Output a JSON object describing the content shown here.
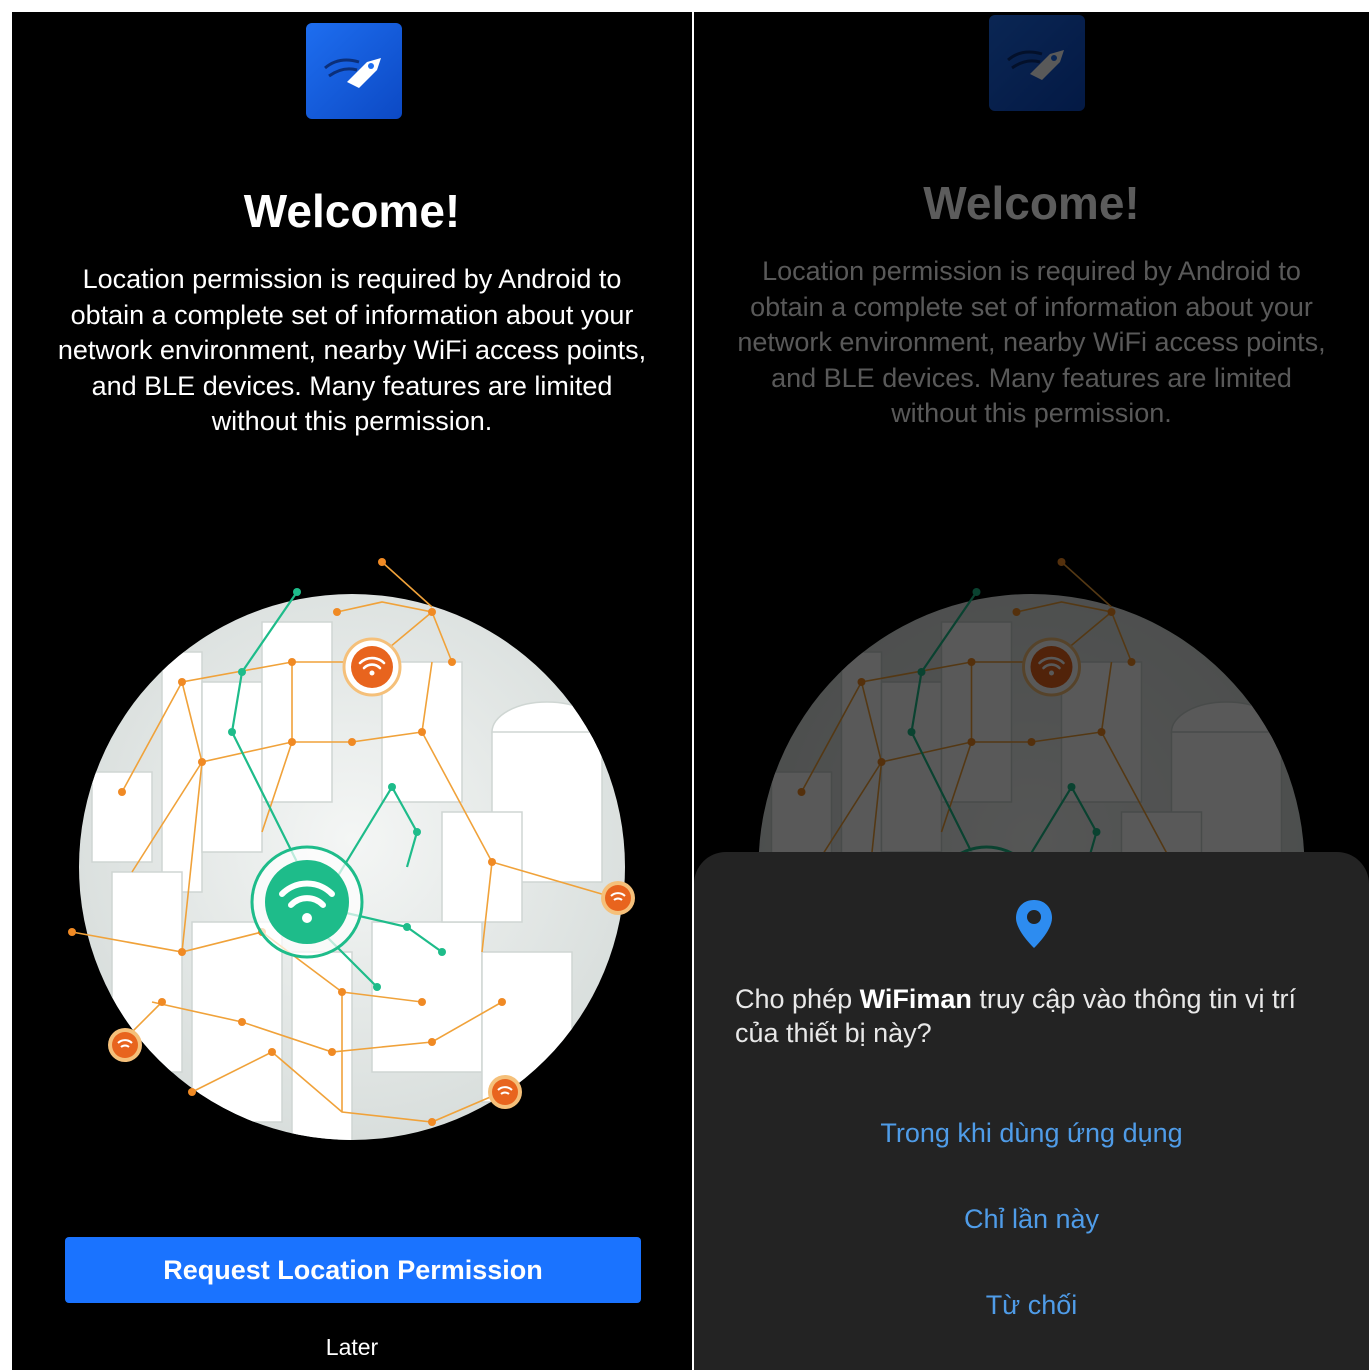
{
  "left_screen": {
    "logo_icon": "wifiman-rocket-icon",
    "title": "Welcome!",
    "description_lines": [
      "Location permission is required by Android to",
      "obtain a complete set of information about your",
      "network environment, nearby WiFi access points,",
      "and BLE devices. Many features are limited",
      "without this permission."
    ],
    "primary_button": "Request Location Permission",
    "secondary_link": "Later"
  },
  "right_screen": {
    "logo_icon": "wifiman-rocket-icon",
    "title": "Welcome!",
    "description_lines": [
      "Location permission is required by Android to",
      "obtain a complete set of information about your",
      "network environment, nearby WiFi access points,",
      "and BLE devices. Many features are limited",
      "without this permission."
    ],
    "dialog": {
      "icon": "location-pin-icon",
      "question_prefix": "Cho phép ",
      "app_name": "WiFiman",
      "question_suffix": " truy cập vào thông tin vị trí",
      "question_line2": "của thiết bị này?",
      "options": [
        "Trong khi dùng ứng dụng",
        "Chỉ lần này",
        "Từ chối"
      ]
    }
  },
  "colors": {
    "primary_blue": "#1a73ff",
    "dialog_option_blue": "#4f9ce8",
    "wifi_green": "#1ebc8a",
    "wifi_orange": "#e8641e",
    "dialog_bg": "#232323"
  }
}
